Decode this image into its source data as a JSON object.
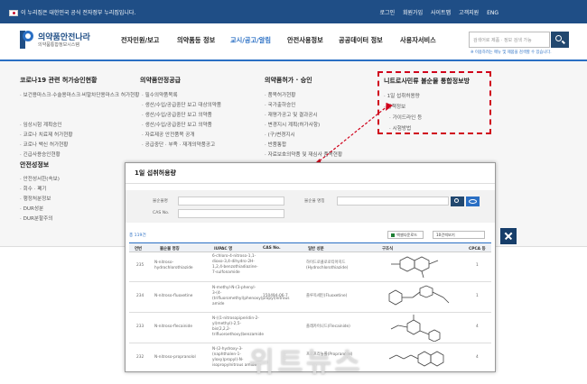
{
  "topbar": {
    "gov_notice": "이 누리집은 대한민국 공식 전자정부 누리집입니다.",
    "links": [
      "로그인",
      "회원가입",
      "사이트맵",
      "고객지원",
      "ENG"
    ]
  },
  "header": {
    "logo_title": "의약품안전나라",
    "logo_sub": "의약품통합정보시스템",
    "nav": [
      "전자민원/보고",
      "의약품등 정보",
      "교시/공고/알림",
      "안전사용정보",
      "공공데이터 정보",
      "사용자서비스"
    ],
    "active_nav": "교시/공고/알림",
    "search_placeholder": "검색어로 제품 · 정보 검색 가능",
    "search_hint": "※ 이용하려는 메뉴 및 제품을 검색할 수 있습니다."
  },
  "mega": {
    "col1": {
      "title": "코로나19 관련 허가승인현황",
      "items": [
        "보건용마스크·수술용마스크·비말차단용마스크 허가현황",
        "임상시험 계획승인",
        "코로나 치료제 허가현황",
        "코로나 백신 허가현황",
        "긴급사용승인현황"
      ]
    },
    "col1b": {
      "title": "안전성정보",
      "items": [
        "안전성서한(속보)",
        "회수 · 폐기",
        "행정처분정보",
        "DUR성분",
        "DUR분할주의"
      ]
    },
    "col2": {
      "title": "의약품안정공급",
      "items": [
        "필수의약품목록",
        "생산/수입/공급중단 보고 대상의약품",
        "생산/수입/공급중단 보고 의약품",
        "생산/수입/공급중단 보고 의약품",
        "자료제공 안전품목 공개",
        "공급중단 · 부족 · 재개의약품공고"
      ]
    },
    "col3": {
      "title": "의약품허가 · 승인",
      "items": [
        "품목허가현황",
        "국가출하승인",
        "재평가공고 및 결과공시",
        "변경지시 계획(허가사항)",
        "(구)변경지시",
        "반품통합",
        "자료보호의약품 및 재심사 품목현황"
      ]
    },
    "col4": {
      "title": "니트로사민류 불순물 통합정보방",
      "items": [
        "1일 섭취허용량",
        "정책정보",
        "가이드라인 등",
        "시험방법"
      ]
    }
  },
  "popup": {
    "title": "1일 섭취허용량",
    "filter_labels": [
      "불순물명",
      "불순물 명칭",
      "CAS No."
    ],
    "count": "총 119건",
    "excel_label": "엑셀다운로드",
    "perpage_label": "10건씩보기",
    "columns": [
      "연번",
      "불순물 명칭",
      "IUPAC 명",
      "CAS No.",
      "일반 성분",
      "구조식",
      "CPCA 등"
    ],
    "rows": [
      {
        "no": "235",
        "name": "N-nitroso-hydrochlorothiazide",
        "iupac": "6-chloro-4-nitroso-1,1-dioxo-3,4-dihydro-2H-1,2,4-benzothiadiazine-7-sulfonamide",
        "cas": "",
        "ingredient": "하이드로클로로티아지드(Hydrochlorothiazide)",
        "cpca": "1"
      },
      {
        "no": "234",
        "name": "N-nitroso-fluoxetine",
        "iupac": "N-methyl-N-(3-phenyl-3-(4-(trifluoromethyl)phenoxy)propyl)nitrous amide",
        "cas": "150494-06-7",
        "ingredient": "플루옥세틴(Fluoxetine)",
        "cpca": "1"
      },
      {
        "no": "233",
        "name": "N-nitroso-flecainide",
        "iupac": "N-((1-nitrosopiperidin-2-yl)methyl)-2,5-bis(2,2,2-trifluoroethoxy)benzamide",
        "cas": "",
        "ingredient": "플레카이니드(Flecainide)",
        "cpca": "4"
      },
      {
        "no": "232",
        "name": "N-nitroso-propranolol",
        "iupac": "N-(2-hydroxy-3-(naphthalen-1-yloxy)propyl)-N-isopropylnitrous amide",
        "cas": "",
        "ingredient": "프로프라놀롤(Propranolol)",
        "cpca": "4"
      }
    ]
  },
  "watermark": "위트뉴스",
  "colors": {
    "primary": "#1f4e86",
    "accent": "#2a6fc4",
    "highlight": "#d0021b"
  }
}
